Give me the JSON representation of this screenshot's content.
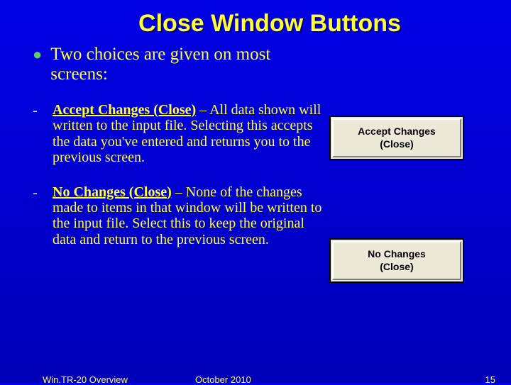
{
  "title": "Close Window Buttons",
  "main_bullet": "Two choices are given on most screens:",
  "sub1_bold": "Accept Changes (Close)",
  "sub1_rest": " – All data shown will written to the input file. Selecting this accepts the data you've entered and returns you to the previous screen.",
  "sub2_bold": "No Changes (Close)",
  "sub2_rest": " – None of the changes made to items in that window will be written to the input file. Select this to keep the original data and return to the previous screen.",
  "btn1_line1": "Accept Changes",
  "btn1_line2": "(Close)",
  "btn2_line1": "No Changes",
  "btn2_line2": "(Close)",
  "footer_left": "Win.TR-20 Overview",
  "footer_center": "October 2010",
  "footer_right": "15"
}
